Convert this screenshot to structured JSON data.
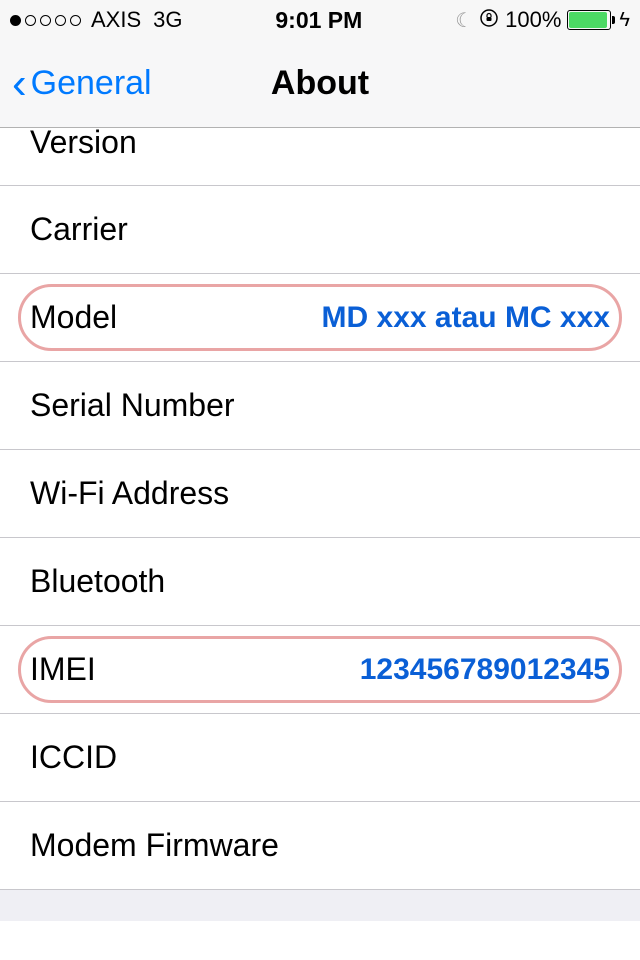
{
  "status": {
    "carrier": "AXIS",
    "network": "3G",
    "time": "9:01 PM",
    "battery": "100%"
  },
  "nav": {
    "back_label": "General",
    "title": "About"
  },
  "rows": {
    "version": {
      "label": "Version",
      "value": ""
    },
    "carrier": {
      "label": "Carrier",
      "value": ""
    },
    "model": {
      "label": "Model",
      "value": "MD xxx atau MC xxx"
    },
    "serial": {
      "label": "Serial Number",
      "value": ""
    },
    "wifi": {
      "label": "Wi-Fi Address",
      "value": ""
    },
    "bluetooth": {
      "label": "Bluetooth",
      "value": ""
    },
    "imei": {
      "label": "IMEI",
      "value": "123456789012345"
    },
    "iccid": {
      "label": "ICCID",
      "value": ""
    },
    "modem": {
      "label": "Modem Firmware",
      "value": ""
    }
  }
}
